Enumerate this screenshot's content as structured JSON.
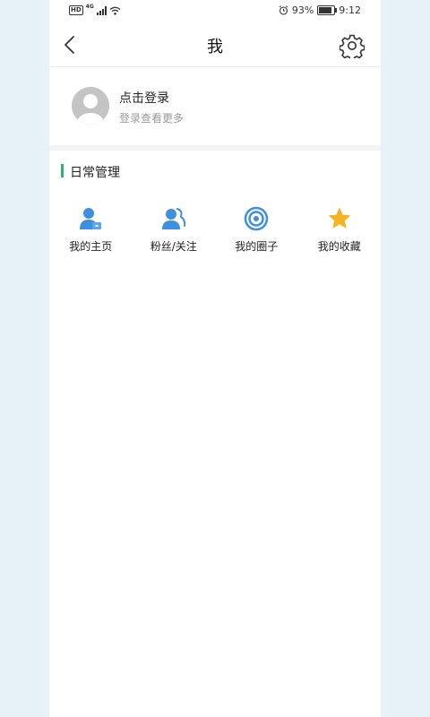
{
  "statusbar": {
    "hd": "HD",
    "network": "4G",
    "battery_percent": "93%",
    "time": "9:12"
  },
  "header": {
    "title": "我"
  },
  "profile": {
    "title": "点击登录",
    "subtitle": "登录查看更多"
  },
  "section": {
    "title": "日常管理",
    "accent_color": "#2db36b"
  },
  "grid": [
    {
      "label": "我的主页",
      "icon": "user-home-icon"
    },
    {
      "label": "粉丝/关注",
      "icon": "fans-follow-icon"
    },
    {
      "label": "我的圈子",
      "icon": "circle-target-icon"
    },
    {
      "label": "我的收藏",
      "icon": "star-icon"
    }
  ],
  "colors": {
    "icon_blue": "#3d8fe0",
    "star_yellow": "#f5b223",
    "page_bg": "#e6f1f8"
  }
}
